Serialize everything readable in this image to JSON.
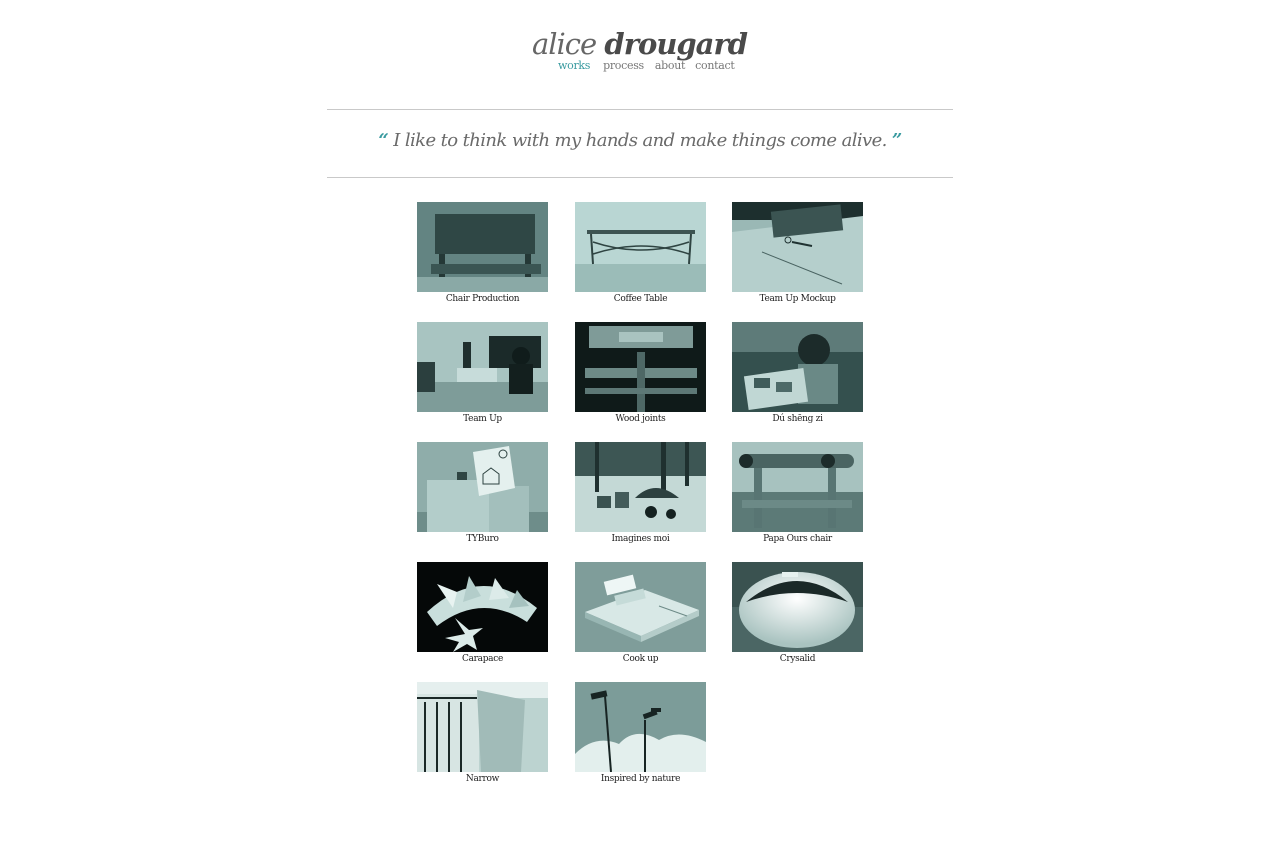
{
  "header": {
    "logo_first": "alice",
    "logo_last": "drougard",
    "nav": [
      {
        "label": "works",
        "active": true
      },
      {
        "label": "process",
        "active": false
      },
      {
        "label": "about",
        "active": false
      },
      {
        "label": "contact",
        "active": false
      }
    ]
  },
  "quote": {
    "open_mark": "“",
    "text": "I like to think with my hands and make things come alive.",
    "close_mark": "”"
  },
  "colors": {
    "accent": "#3a9ba0",
    "text": "#555555",
    "rule": "#c9c9c9",
    "thumb_tint": "#6f9593"
  },
  "works": [
    {
      "title": "Chair Production",
      "image": "chair-photo"
    },
    {
      "title": "Coffee Table",
      "image": "coffee-table-photo"
    },
    {
      "title": "Team Up Mockup",
      "image": "mockup-photo"
    },
    {
      "title": "Team Up",
      "image": "office-photo"
    },
    {
      "title": "Wood joints",
      "image": "wood-joints-photo"
    },
    {
      "title": "Dú shēng zi",
      "image": "child-reading-photo"
    },
    {
      "title": "TYBuro",
      "image": "tyburo-photo"
    },
    {
      "title": "Imagines moi",
      "image": "park-photo"
    },
    {
      "title": "Papa Ours chair",
      "image": "log-chair-photo"
    },
    {
      "title": "Carapace",
      "image": "carapace-render"
    },
    {
      "title": "Cook up",
      "image": "cookup-render"
    },
    {
      "title": "Crysalid",
      "image": "crysalid-render"
    },
    {
      "title": "Narrow",
      "image": "narrow-photo"
    },
    {
      "title": "Inspired by nature",
      "image": "lamp-posts-photo"
    }
  ]
}
